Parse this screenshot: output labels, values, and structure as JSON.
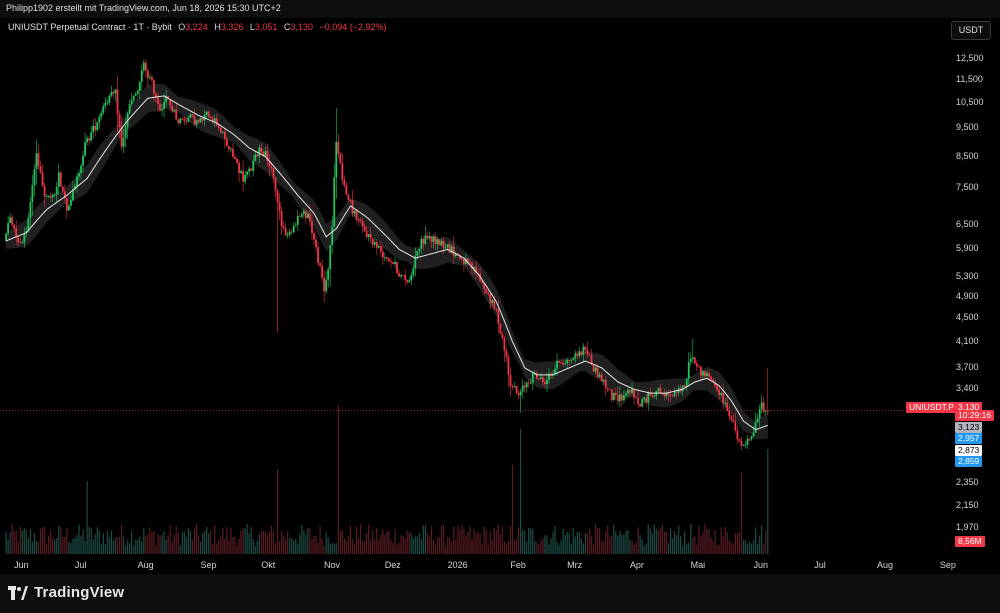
{
  "header": {
    "credit": "Philipp1902 erstellt mit TradingView.com, Jun 18, 2026 15:30 UTC+2"
  },
  "legend": {
    "symbol": "UNIUSDT Perpetual Contract · 1T · Bybit",
    "o_label": "O",
    "o": "3,224",
    "h_label": "H",
    "h": "3,326",
    "l_label": "L",
    "l": "3,051",
    "c_label": "C",
    "c": "3,130",
    "change": "−0,094 (−2,92%)"
  },
  "currency_button": "USDT",
  "footer": {
    "brand": "TradingView"
  },
  "colors": {
    "up": "#26a69a",
    "down": "#f23645",
    "up_bright": "#22c55e",
    "ma": "#e6e6e6",
    "band": "#3a3a3a",
    "last": "#f23645"
  },
  "chart_data": {
    "type": "candlestick",
    "scale": "log",
    "ylim": [
      1820,
      14000
    ],
    "y_ticks": [
      {
        "label": "12,500",
        "value": 12500
      },
      {
        "label": "11,500",
        "value": 11500
      },
      {
        "label": "10,500",
        "value": 10500
      },
      {
        "label": "9,500",
        "value": 9500
      },
      {
        "label": "8,500",
        "value": 8500
      },
      {
        "label": "7,500",
        "value": 7500
      },
      {
        "label": "6,500",
        "value": 6500
      },
      {
        "label": "5,900",
        "value": 5900
      },
      {
        "label": "5,300",
        "value": 5300
      },
      {
        "label": "4,900",
        "value": 4900
      },
      {
        "label": "4,500",
        "value": 4500
      },
      {
        "label": "4,100",
        "value": 4100
      },
      {
        "label": "3,700",
        "value": 3700
      },
      {
        "label": "3,400",
        "value": 3400
      },
      {
        "label": "2,350",
        "value": 2350
      },
      {
        "label": "2,150",
        "value": 2150
      },
      {
        "label": "1,970",
        "value": 1970
      }
    ],
    "x_ticks": [
      {
        "label": "Jun",
        "day": 0
      },
      {
        "label": "Jul",
        "day": 30
      },
      {
        "label": "Aug",
        "day": 61
      },
      {
        "label": "Sep",
        "day": 92
      },
      {
        "label": "Okt",
        "day": 122
      },
      {
        "label": "Nov",
        "day": 153
      },
      {
        "label": "Dez",
        "day": 183
      },
      {
        "label": "2026",
        "day": 214
      },
      {
        "label": "Feb",
        "day": 245
      },
      {
        "label": "Mrz",
        "day": 273
      },
      {
        "label": "Apr",
        "day": 304
      },
      {
        "label": "Mai",
        "day": 334
      },
      {
        "label": "Jun",
        "day": 365
      },
      {
        "label": "Jul",
        "day": 395
      },
      {
        "label": "Aug",
        "day": 426
      },
      {
        "label": "Sep",
        "day": 457
      }
    ],
    "x_range_days": [
      -3,
      463
    ],
    "price_tags": [
      {
        "label": "UNIUSDT.P",
        "value": "3,130",
        "style": "last"
      },
      {
        "label": "",
        "value": "10:29:16",
        "style": "timer"
      },
      {
        "label": "",
        "value": "3,123",
        "style": "gray"
      },
      {
        "label": "",
        "value": "2,957",
        "style": "blue"
      },
      {
        "label": "",
        "value": "2,873",
        "style": "white"
      },
      {
        "label": "",
        "value": "2,859",
        "style": "blue"
      },
      {
        "label": "",
        "value": "8,56M",
        "style": "vol"
      }
    ],
    "last_price": 3.13,
    "keypoints": [
      [
        0,
        6.1
      ],
      [
        3,
        6.7
      ],
      [
        8,
        6.0
      ],
      [
        12,
        6.6
      ],
      [
        16,
        8.6
      ],
      [
        20,
        7.4
      ],
      [
        24,
        7.2
      ],
      [
        27,
        7.9
      ],
      [
        31,
        7.0
      ],
      [
        35,
        7.5
      ],
      [
        40,
        8.9
      ],
      [
        45,
        9.6
      ],
      [
        50,
        10.6
      ],
      [
        55,
        10.9
      ],
      [
        58,
        8.8
      ],
      [
        62,
        10.4
      ],
      [
        66,
        11.0
      ],
      [
        69,
        12.2
      ],
      [
        73,
        11.3
      ],
      [
        77,
        10.3
      ],
      [
        80,
        10.7
      ],
      [
        86,
        9.8
      ],
      [
        92,
        9.9
      ],
      [
        96,
        9.7
      ],
      [
        101,
        10.1
      ],
      [
        106,
        9.6
      ],
      [
        110,
        8.9
      ],
      [
        114,
        8.4
      ],
      [
        118,
        7.8
      ],
      [
        122,
        8.1
      ],
      [
        126,
        8.8
      ],
      [
        130,
        8.5
      ],
      [
        134,
        7.5
      ],
      [
        137,
        6.5
      ],
      [
        140,
        6.2
      ],
      [
        145,
        6.7
      ],
      [
        150,
        6.8
      ],
      [
        154,
        5.9
      ],
      [
        158,
        5.0
      ],
      [
        160,
        5.5
      ],
      [
        162,
        6.5
      ],
      [
        164,
        9.0
      ],
      [
        168,
        7.5
      ],
      [
        172,
        6.9
      ],
      [
        177,
        6.4
      ],
      [
        182,
        6.1
      ],
      [
        187,
        5.8
      ],
      [
        192,
        5.6
      ],
      [
        196,
        5.3
      ],
      [
        200,
        5.2
      ],
      [
        204,
        5.9
      ],
      [
        208,
        6.2
      ],
      [
        213,
        6.1
      ],
      [
        218,
        6.0
      ],
      [
        223,
        5.8
      ],
      [
        228,
        5.6
      ],
      [
        233,
        5.4
      ],
      [
        238,
        5.0
      ],
      [
        243,
        4.6
      ],
      [
        247,
        4.0
      ],
      [
        250,
        3.5
      ],
      [
        254,
        3.3
      ],
      [
        258,
        3.5
      ],
      [
        262,
        3.6
      ],
      [
        266,
        3.5
      ],
      [
        270,
        3.6
      ],
      [
        274,
        3.8
      ],
      [
        278,
        3.8
      ],
      [
        283,
        3.9
      ],
      [
        287,
        4.0
      ],
      [
        291,
        3.7
      ],
      [
        296,
        3.5
      ],
      [
        300,
        3.3
      ],
      [
        305,
        3.3
      ],
      [
        309,
        3.4
      ],
      [
        313,
        3.2
      ],
      [
        318,
        3.3
      ],
      [
        322,
        3.4
      ],
      [
        327,
        3.3
      ],
      [
        332,
        3.4
      ],
      [
        336,
        3.4
      ],
      [
        339,
        3.9
      ],
      [
        342,
        3.7
      ],
      [
        346,
        3.6
      ],
      [
        350,
        3.5
      ],
      [
        354,
        3.3
      ],
      [
        358,
        3.1
      ],
      [
        362,
        2.8
      ],
      [
        364,
        2.7
      ],
      [
        366,
        2.75
      ],
      [
        369,
        2.8
      ],
      [
        371,
        2.95
      ],
      [
        374,
        3.2
      ],
      [
        376,
        3.13
      ]
    ],
    "ma_keypoints": [
      [
        0,
        6.1
      ],
      [
        10,
        6.3
      ],
      [
        20,
        6.9
      ],
      [
        30,
        7.3
      ],
      [
        40,
        7.8
      ],
      [
        50,
        8.8
      ],
      [
        60,
        9.8
      ],
      [
        70,
        10.7
      ],
      [
        78,
        10.8
      ],
      [
        86,
        10.4
      ],
      [
        95,
        10.0
      ],
      [
        104,
        9.7
      ],
      [
        112,
        9.3
      ],
      [
        120,
        8.8
      ],
      [
        128,
        8.5
      ],
      [
        136,
        7.9
      ],
      [
        144,
        7.3
      ],
      [
        152,
        6.8
      ],
      [
        158,
        6.2
      ],
      [
        163,
        6.4
      ],
      [
        170,
        7.0
      ],
      [
        178,
        6.7
      ],
      [
        186,
        6.3
      ],
      [
        194,
        5.9
      ],
      [
        202,
        5.7
      ],
      [
        210,
        5.8
      ],
      [
        218,
        5.9
      ],
      [
        226,
        5.7
      ],
      [
        234,
        5.3
      ],
      [
        242,
        4.8
      ],
      [
        250,
        4.1
      ],
      [
        256,
        3.7
      ],
      [
        262,
        3.6
      ],
      [
        270,
        3.6
      ],
      [
        278,
        3.7
      ],
      [
        286,
        3.8
      ],
      [
        294,
        3.7
      ],
      [
        302,
        3.5
      ],
      [
        310,
        3.4
      ],
      [
        318,
        3.35
      ],
      [
        326,
        3.35
      ],
      [
        334,
        3.4
      ],
      [
        340,
        3.5
      ],
      [
        346,
        3.55
      ],
      [
        352,
        3.45
      ],
      [
        358,
        3.25
      ],
      [
        364,
        3.0
      ],
      [
        370,
        2.9
      ],
      [
        376,
        2.95
      ]
    ],
    "spikes": [
      [
        163,
        10.3,
        "high"
      ],
      [
        134,
        4.25,
        "low"
      ],
      [
        254,
        3.1,
        "low"
      ],
      [
        376,
        3.7,
        "high"
      ],
      [
        339,
        4.15,
        "high"
      ],
      [
        69,
        12.4,
        "high"
      ]
    ],
    "volume_scale_note": "bottom pane",
    "volume_spikes": [
      [
        134,
        1.0
      ],
      [
        164,
        2.6
      ],
      [
        254,
        2.0
      ],
      [
        376,
        1.5
      ],
      [
        250,
        1.1
      ],
      [
        363,
        0.9
      ],
      [
        40,
        0.7
      ]
    ]
  }
}
